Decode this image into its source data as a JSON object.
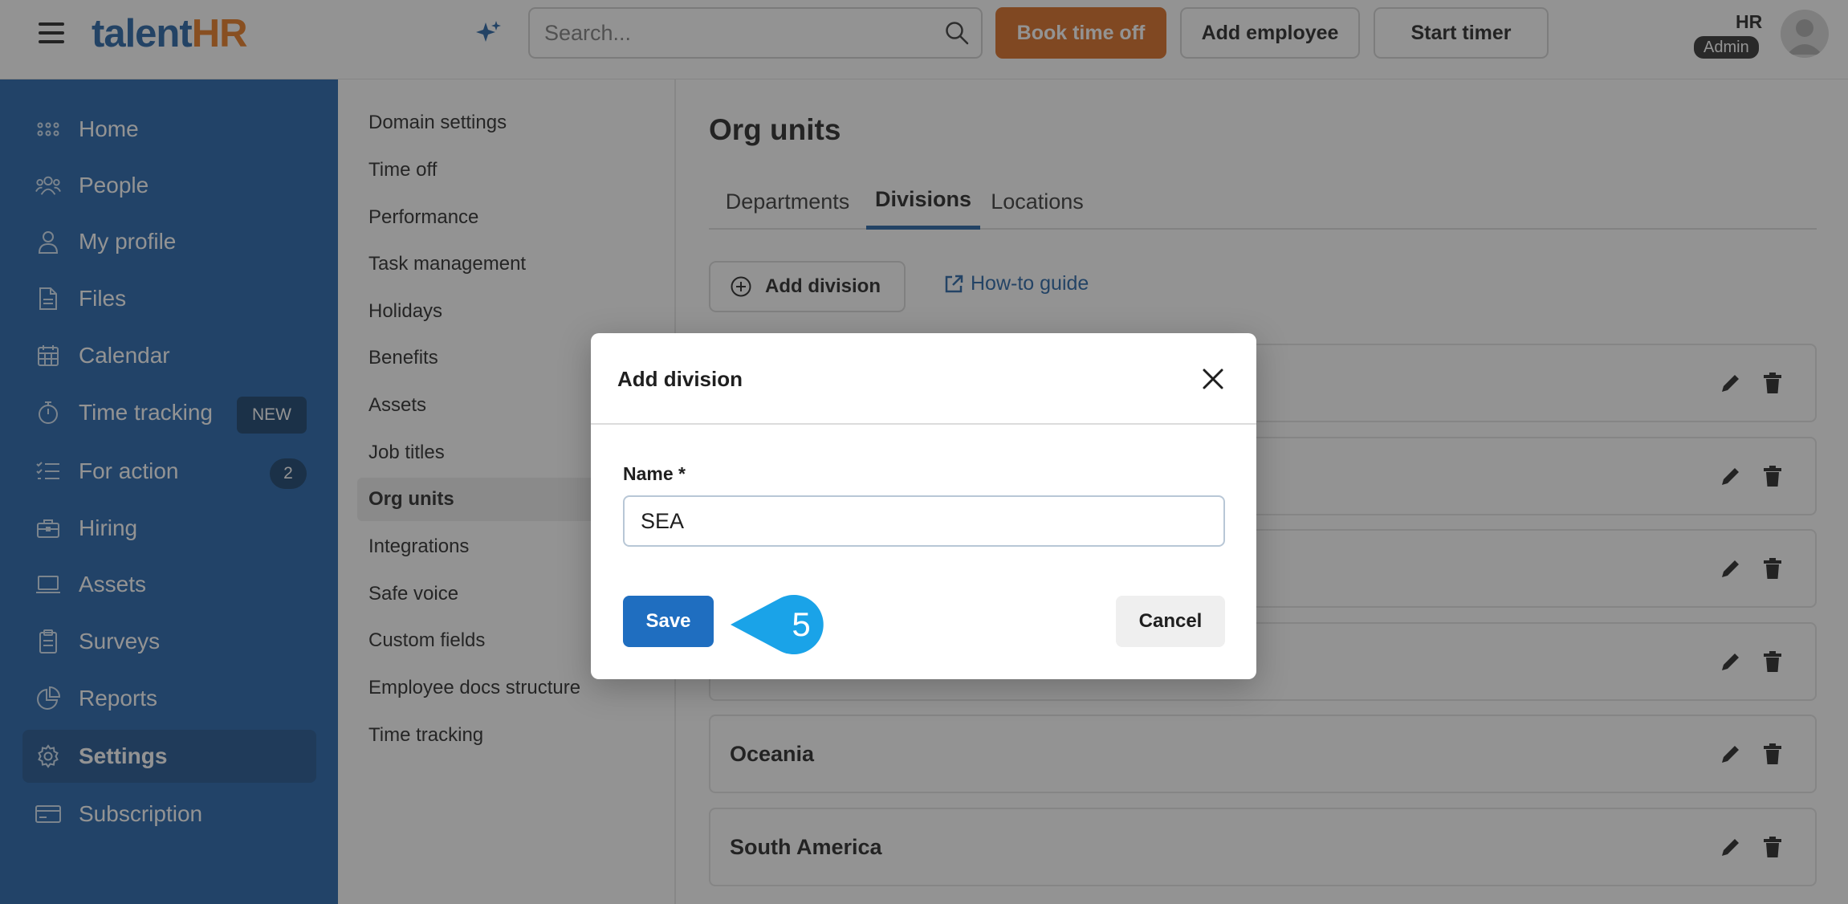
{
  "header": {
    "logo_part1": "talent",
    "logo_part2": "HR",
    "search_placeholder": "Search...",
    "book_time_off": "Book time off",
    "add_employee": "Add employee",
    "start_timer": "Start timer",
    "user_name": "HR",
    "user_role": "Admin"
  },
  "sidebar": {
    "items": [
      {
        "label": "Home",
        "icon": "home-grid-icon"
      },
      {
        "label": "People",
        "icon": "people-icon"
      },
      {
        "label": "My profile",
        "icon": "user-icon"
      },
      {
        "label": "Files",
        "icon": "file-icon"
      },
      {
        "label": "Calendar",
        "icon": "calendar-icon"
      },
      {
        "label": "Time tracking",
        "icon": "stopwatch-icon",
        "badge": "NEW"
      },
      {
        "label": "For action",
        "icon": "checklist-icon",
        "count": "2"
      },
      {
        "label": "Hiring",
        "icon": "briefcase-icon"
      },
      {
        "label": "Assets",
        "icon": "laptop-icon"
      },
      {
        "label": "Surveys",
        "icon": "clipboard-icon"
      },
      {
        "label": "Reports",
        "icon": "pie-chart-icon"
      },
      {
        "label": "Settings",
        "icon": "gear-icon",
        "active": true
      },
      {
        "label": "Subscription",
        "icon": "credit-card-icon"
      }
    ]
  },
  "settings_menu": {
    "items": [
      "Domain settings",
      "Time off",
      "Performance",
      "Task management",
      "Holidays",
      "Benefits",
      "Assets",
      "Job titles",
      "Org units",
      "Integrations",
      "Safe voice",
      "Custom fields",
      "Employee docs structure",
      "Time tracking"
    ],
    "active": "Org units"
  },
  "main": {
    "title": "Org units",
    "tabs": [
      "Departments",
      "Divisions",
      "Locations"
    ],
    "active_tab": "Divisions",
    "add_division_label": "Add division",
    "howto_label": "How-to guide",
    "divisions": [
      "",
      "",
      "",
      "",
      "Oceania",
      "South America"
    ]
  },
  "modal": {
    "title": "Add division",
    "name_label": "Name *",
    "name_value": "SEA",
    "save_label": "Save",
    "cancel_label": "Cancel",
    "step_number": "5"
  },
  "colors": {
    "brand_blue": "#1c5fa8",
    "brand_orange": "#d9691d",
    "save_blue": "#1f6ec0",
    "marker_blue": "#1aa3e8"
  }
}
